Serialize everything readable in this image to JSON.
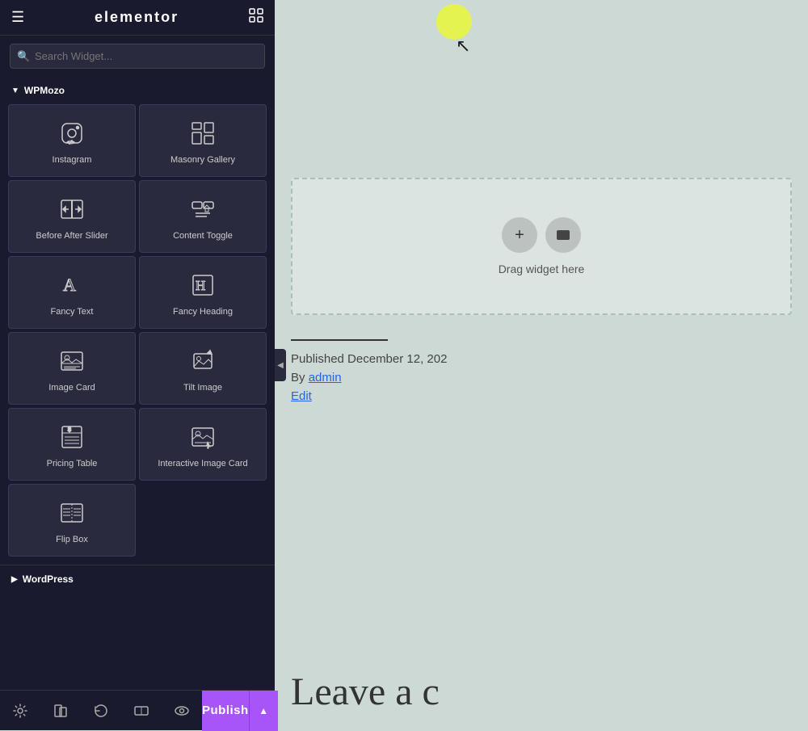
{
  "topbar": {
    "brand": "elementor",
    "hamburger_symbol": "☰",
    "grid_symbol": "⊞"
  },
  "search": {
    "placeholder": "Search Widget..."
  },
  "wpmozo_section": {
    "label": "WPMozo",
    "arrow": "▼"
  },
  "widgets": [
    {
      "id": "instagram",
      "label": "Instagram",
      "icon": "instagram"
    },
    {
      "id": "masonry-gallery",
      "label": "Masonry Gallery",
      "icon": "masonry"
    },
    {
      "id": "before-after-slider",
      "label": "Before After Slider",
      "icon": "before-after"
    },
    {
      "id": "content-toggle",
      "label": "Content Toggle",
      "icon": "toggle"
    },
    {
      "id": "fancy-text",
      "label": "Fancy Text",
      "icon": "fancy-text"
    },
    {
      "id": "fancy-heading",
      "label": "Fancy Heading",
      "icon": "fancy-heading"
    },
    {
      "id": "image-card",
      "label": "Image Card",
      "icon": "image-card"
    },
    {
      "id": "tilt-image",
      "label": "Tilt Image",
      "icon": "tilt-image"
    },
    {
      "id": "pricing-table",
      "label": "Pricing Table",
      "icon": "pricing"
    },
    {
      "id": "interactive-image-card",
      "label": "Interactive Image Card",
      "icon": "interactive-image"
    },
    {
      "id": "flip-box",
      "label": "Flip Box",
      "icon": "flip-box"
    }
  ],
  "wordpress_section": {
    "label": "WordPress",
    "arrow": "▶"
  },
  "toolbar": {
    "gear_symbol": "⚙",
    "layers_symbol": "◧",
    "history_symbol": "↺",
    "responsive_symbol": "⊡",
    "eye_symbol": "👁",
    "publish_label": "Publish",
    "chevron_symbol": "▲"
  },
  "canvas": {
    "drag_label": "Drag widget here",
    "published_date": "Published December 12, 202",
    "published_by_label": "By",
    "published_by_user": "admin",
    "edit_label": "Edit",
    "leave_comment": "Leave a c"
  }
}
